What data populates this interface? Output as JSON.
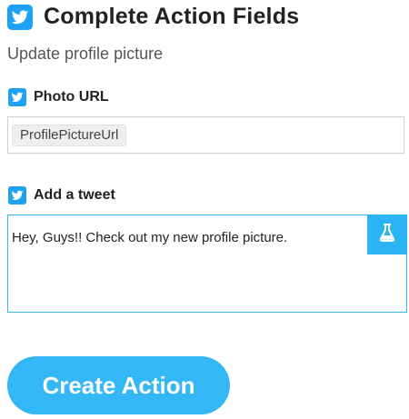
{
  "header": {
    "title": "Complete Action Fields",
    "subtitle": "Update profile picture",
    "icon": "twitter-icon"
  },
  "fields": {
    "photo_url": {
      "label": "Photo URL",
      "icon": "twitter-icon",
      "ingredient": "ProfilePictureUrl"
    },
    "tweet": {
      "label": "Add a tweet",
      "icon": "twitter-icon",
      "value": "Hey, Guys!! Check out my new profile picture.",
      "ingredient_button_icon": "flask-icon"
    }
  },
  "actions": {
    "create_label": "Create Action"
  },
  "colors": {
    "twitter_blue": "#1da1f2",
    "accent_blue": "#33b7f5",
    "focus_border": "#35b6f4"
  }
}
